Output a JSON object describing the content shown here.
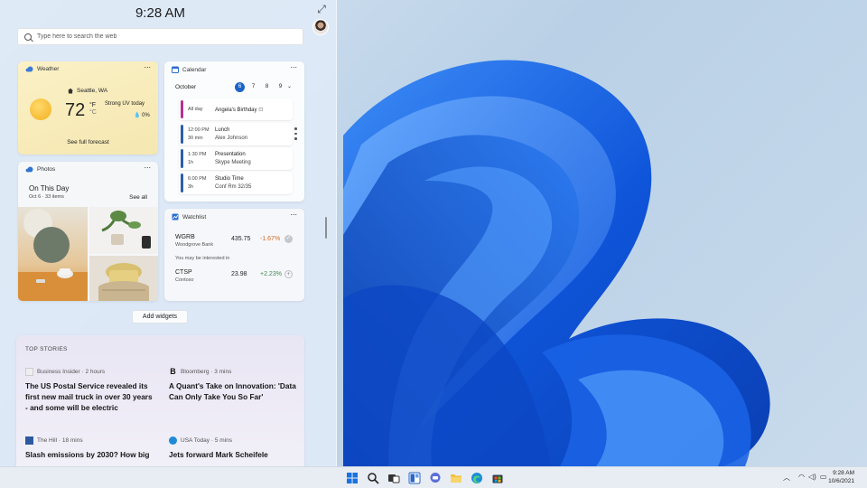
{
  "panel": {
    "time": "9:28 AM",
    "search_placeholder": "Type here to search the web"
  },
  "weather": {
    "title": "Weather",
    "location": "Seattle, WA",
    "temp": "72",
    "unit_primary": "°F",
    "unit_alt": "°C",
    "condition": "Strong UV today",
    "precip": "0%",
    "link": "See full forecast"
  },
  "calendar": {
    "title": "Calendar",
    "month": "October",
    "days": [
      "6",
      "7",
      "8",
      "9"
    ],
    "selected_day": "6",
    "events": [
      {
        "time": "All day",
        "duration": "",
        "name": "Angela's Birthday",
        "detail": "",
        "color": "#b4318f"
      },
      {
        "time": "12:00 PM",
        "duration": "30 min",
        "name": "Lunch",
        "detail": "Alex Johnson",
        "color": "#2b5ea8"
      },
      {
        "time": "1:30 PM",
        "duration": "1h",
        "name": "Presentation",
        "detail": "Skype Meeting",
        "color": "#2b5ea8"
      },
      {
        "time": "6:00 PM",
        "duration": "3h",
        "name": "Studio Time",
        "detail": "Conf Rm 32/35",
        "color": "#2b5ea8"
      }
    ]
  },
  "photos": {
    "title": "Photos",
    "heading": "On This Day",
    "date": "Oct 6",
    "count": "33 items",
    "see_all": "See all"
  },
  "watchlist": {
    "title": "Watchlist",
    "maybe_label": "You may be interested in",
    "stocks": [
      {
        "ticker": "WGRB",
        "company": "Woodgrove Bank",
        "price": "435.75",
        "change": "-1.67%",
        "change_color": "#d06c2a",
        "action": "✓"
      },
      {
        "ticker": "CTSP",
        "company": "Contoso",
        "price": "23.98",
        "change": "+2.23%",
        "change_color": "#3f8a52",
        "action": "+"
      }
    ]
  },
  "add_widgets": "Add widgets",
  "top_stories": {
    "heading": "TOP STORIES",
    "items": [
      {
        "source": "Business Insider",
        "age": "2 hours",
        "logo": "",
        "title": "The US Postal Service revealed its first new mail truck in over 30 years - and some will be electric"
      },
      {
        "source": "Bloomberg",
        "age": "3 mins",
        "logo": "B",
        "title": "A Quant's Take on Innovation: 'Data Can Only Take You So Far'"
      },
      {
        "source": "The Hill",
        "age": "18 mins",
        "logo": "",
        "title": "Slash emissions by 2030? How big"
      },
      {
        "source": "USA Today",
        "age": "5 mins",
        "logo": "",
        "title": "Jets forward Mark Scheifele"
      }
    ]
  },
  "taskbar": {
    "time": "9:28 AM",
    "date": "10/6/2021",
    "apps": [
      "start-icon",
      "search-icon",
      "task-view-icon",
      "widgets-icon",
      "chat-icon",
      "file-explorer-icon",
      "edge-icon",
      "store-icon"
    ]
  },
  "colors": {
    "accent": "#1a64c7",
    "wallpaper_bloom": "#1565e0"
  }
}
